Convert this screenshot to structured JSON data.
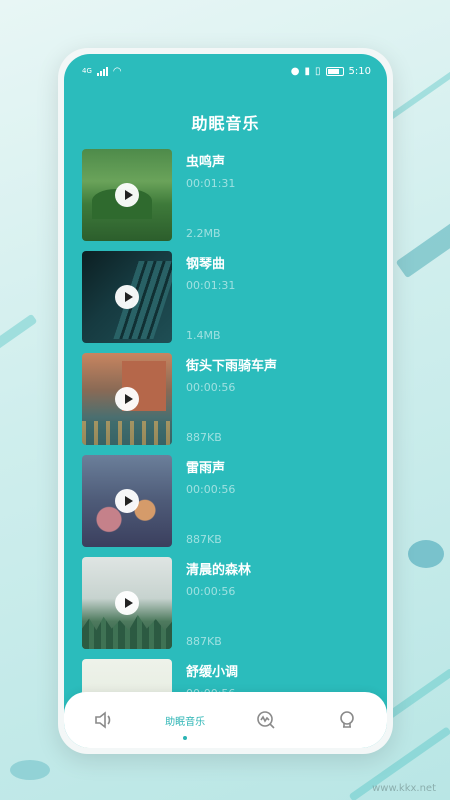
{
  "status_bar": {
    "signal_text": "4G",
    "time": "5:10"
  },
  "page": {
    "title": "助眠音乐"
  },
  "tracks": [
    {
      "name": "虫鸣声",
      "duration": "00:01:31",
      "size": "2.2MB",
      "thumbnail": "green-meadow-image"
    },
    {
      "name": "钢琴曲",
      "duration": "00:01:31",
      "size": "1.4MB",
      "thumbnail": "piano-keys-image"
    },
    {
      "name": "街头下雨骑车声",
      "duration": "00:00:56",
      "size": "887KB",
      "thumbnail": "rainy-street-image"
    },
    {
      "name": "雷雨声",
      "duration": "00:00:56",
      "size": "887KB",
      "thumbnail": "rain-window-image"
    },
    {
      "name": "清晨的森林",
      "duration": "00:00:56",
      "size": "887KB",
      "thumbnail": "misty-forest-image"
    },
    {
      "name": "舒缓小调",
      "duration": "00:00:56",
      "size": "",
      "thumbnail": "soft-flower-image"
    }
  ],
  "bottom_nav": {
    "items": [
      {
        "icon": "speaker-icon",
        "label": ""
      },
      {
        "icon": "",
        "label": "助眠音乐",
        "active": true
      },
      {
        "icon": "wave-search-icon",
        "label": ""
      },
      {
        "icon": "user-icon",
        "label": ""
      }
    ]
  },
  "watermark": "www.kkx.net",
  "colors": {
    "accent": "#2bbcbc",
    "nav_active": "#2bb4b4"
  }
}
